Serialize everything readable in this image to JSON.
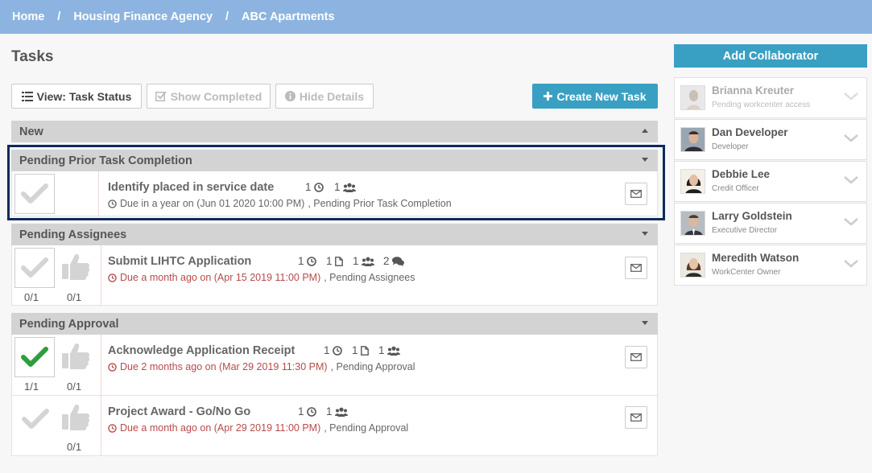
{
  "breadcrumb": {
    "items": [
      "Home",
      "Housing Finance Agency",
      "ABC Apartments"
    ],
    "separator": "/"
  },
  "page": {
    "title": "Tasks"
  },
  "toolbar": {
    "view_label": "View: Task Status",
    "show_completed_label": "Show Completed",
    "hide_details_label": "Hide Details",
    "create_label": "Create New Task"
  },
  "sections": {
    "new": {
      "label": "New"
    },
    "pending_prior": {
      "label": "Pending Prior Task Completion"
    },
    "pending_assignees": {
      "label": "Pending Assignees"
    },
    "pending_approval": {
      "label": "Pending Approval"
    }
  },
  "tasks": {
    "t1": {
      "title": "Identify placed in service date",
      "clock_count": "1",
      "people_count": "1",
      "due_text": "Due in a year on (Jun 01 2020 10:00 PM)",
      "status_text": ", Pending Prior Task Completion"
    },
    "t2": {
      "title": "Submit LIHTC Application",
      "clock_count": "1",
      "doc_count": "1",
      "people_count": "1",
      "comment_count": "2",
      "due_text": "Due a month ago on (Apr 15 2019 11:00 PM)",
      "status_text": ", Pending Assignees",
      "check_count": "0/1",
      "approve_count": "0/1"
    },
    "t3": {
      "title": "Acknowledge Application Receipt",
      "clock_count": "1",
      "doc_count": "1",
      "people_count": "1",
      "due_text": "Due 2 months ago on (Mar 29 2019 11:30 PM)",
      "status_text": ", Pending Approval",
      "check_count": "1/1",
      "approve_count": "0/1"
    },
    "t4": {
      "title": "Project Award - Go/No Go",
      "clock_count": "1",
      "people_count": "1",
      "due_text": "Due a month ago on (Apr 29 2019 11:00 PM)",
      "status_text": ", Pending Approval",
      "approve_count": "0/1"
    }
  },
  "collaborators": {
    "add_label": "Add Collaborator",
    "items": [
      {
        "name": "Brianna Kreuter",
        "role": "Pending workcenter access"
      },
      {
        "name": "Dan Developer",
        "role": "Developer"
      },
      {
        "name": "Debbie Lee",
        "role": "Credit Officer"
      },
      {
        "name": "Larry Goldstein",
        "role": "Executive Director"
      },
      {
        "name": "Meredith Watson",
        "role": "WorkCenter Owner"
      }
    ]
  },
  "colors": {
    "topbar": "#8db4e0",
    "accent": "#3aa0c3",
    "overdue": "#b84a4a",
    "check_done": "#2e9e3e",
    "highlight": "#0f2a5c"
  }
}
